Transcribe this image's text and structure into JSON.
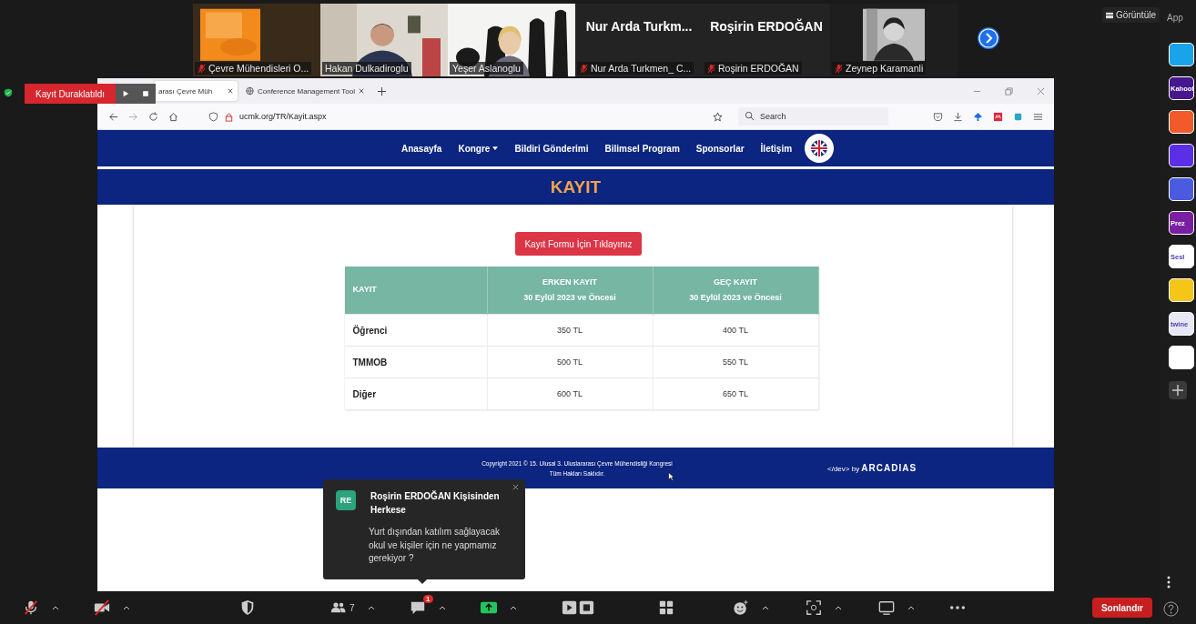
{
  "recording": {
    "label": "Kayıt Duraklatıldı"
  },
  "participants": [
    {
      "kind": "picture",
      "name": "Çevre Mühendisleri O...",
      "muted": true
    },
    {
      "kind": "picture",
      "name": "Hakan Dulkadiroglu",
      "muted": false
    },
    {
      "kind": "picture",
      "name": "Yeşer Aslanoglu",
      "muted": false
    },
    {
      "kind": "name",
      "display": "Nur Arda Turkm...",
      "name": "Nur Arda Turkmen_ C...",
      "muted": true
    },
    {
      "kind": "name",
      "display": "Roşirin ERDOĞAN",
      "name": "Roşirin ERDOĞAN",
      "muted": true
    },
    {
      "kind": "picture",
      "name": "Zeynep Karamanli",
      "muted": true
    }
  ],
  "view_button": "Görüntüle",
  "apps_panel": {
    "title": "App",
    "apps": [
      {
        "color": "#1aa3e8"
      },
      {
        "color": "#46178f",
        "label": "Kahoot"
      },
      {
        "color": "#f25a29"
      },
      {
        "color": "#5b2ee8"
      },
      {
        "color": "#4a5be0"
      },
      {
        "color": "#7a1fa2",
        "label": "Prez"
      },
      {
        "color": "#ffffff",
        "label": "Sesl"
      },
      {
        "color": "#f5c518"
      },
      {
        "color": "#e8e8f4",
        "label": "twine"
      },
      {
        "color": "#ffffff"
      }
    ]
  },
  "browser": {
    "tabs": [
      {
        "label": "arası Çevre Müh",
        "selected": true
      },
      {
        "label": "Conference Management Tool",
        "selected": false
      }
    ],
    "url": "ucmk.org/TR/Kayit.aspx",
    "search_placeholder": "Search"
  },
  "site": {
    "nav": [
      {
        "label": "Anasayfa",
        "dropdown": false
      },
      {
        "label": "Kongre",
        "dropdown": true
      },
      {
        "label": "Bildiri Gönderimi",
        "dropdown": false
      },
      {
        "label": "Bilimsel Program",
        "dropdown": false
      },
      {
        "label": "Sponsorlar",
        "dropdown": false
      },
      {
        "label": "İletişim",
        "dropdown": false
      }
    ],
    "page_title": "KAYIT",
    "register_button": "Kayıt Formu İçin Tıklayınız",
    "table": {
      "columns": [
        {
          "label": "KAYIT"
        },
        {
          "label": "ERKEN KAYIT",
          "subtitle": "30 Eylül 2023 ve Öncesi"
        },
        {
          "label": "GEÇ KAYIT",
          "subtitle": "30 Eylül 2023 ve Öncesi"
        }
      ],
      "rows": [
        [
          "Öğrenci",
          "350 TL",
          "400 TL"
        ],
        [
          "TMMOB",
          "500 TL",
          "550 TL"
        ],
        [
          "Diğer",
          "600 TL",
          "650 TL"
        ]
      ]
    },
    "footer": {
      "copyright": "Copyright 2021 © 15. Ulusal 3. Uluslararası Çevre Mühendisliği Kongresi",
      "rights": "Tüm Hakları Saklıdır.",
      "credit_prefix": "</dev> by",
      "credit_brand": "ARCADIAS"
    }
  },
  "chat": {
    "initials": "RE",
    "sender": "Roşirin ERDOĞAN Kişisinden Herkese",
    "message": "Yurt dışından katılım sağlayacak okul ve kişiler için ne yapmamız gerekiyor ?"
  },
  "toolbar": {
    "participants_count": "7",
    "chat_badge": "1",
    "end_button": "Sonlandır"
  }
}
